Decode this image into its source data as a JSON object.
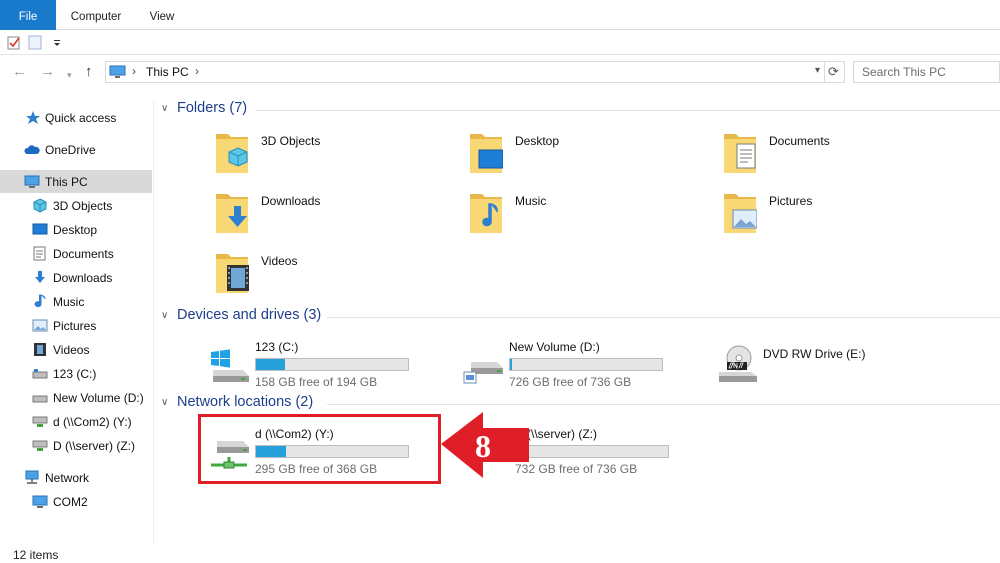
{
  "ribbon": {
    "tabs": [
      "File",
      "Computer",
      "View"
    ]
  },
  "address": {
    "path": "This PC",
    "search_placeholder": "Search This PC"
  },
  "sidebar": {
    "items": [
      {
        "label": "Quick access",
        "icon": "star-icon"
      },
      {
        "label": "OneDrive",
        "icon": "cloud-icon"
      },
      {
        "label": "This PC",
        "icon": "monitor-icon"
      },
      {
        "label": "3D Objects",
        "icon": "cube-icon"
      },
      {
        "label": "Desktop",
        "icon": "desktop-icon"
      },
      {
        "label": "Documents",
        "icon": "document-icon"
      },
      {
        "label": "Downloads",
        "icon": "download-icon"
      },
      {
        "label": "Music",
        "icon": "music-icon"
      },
      {
        "label": "Pictures",
        "icon": "pictures-icon"
      },
      {
        "label": "Videos",
        "icon": "videos-icon"
      },
      {
        "label": "123 (C:)",
        "icon": "drive-icon"
      },
      {
        "label": "New Volume (D:)",
        "icon": "drive-icon"
      },
      {
        "label": "d (\\\\Com2) (Y:)",
        "icon": "network-drive-icon"
      },
      {
        "label": "D (\\\\server) (Z:)",
        "icon": "network-drive-icon"
      },
      {
        "label": "Network",
        "icon": "network-icon"
      },
      {
        "label": "COM2",
        "icon": "computer-icon"
      }
    ]
  },
  "groups": {
    "folders": {
      "title": "Folders (7)",
      "items": [
        "3D Objects",
        "Desktop",
        "Documents",
        "Downloads",
        "Music",
        "Pictures",
        "Videos"
      ]
    },
    "devices": {
      "title": "Devices and drives (3)",
      "items": [
        {
          "label": "123 (C:)",
          "free": "158 GB free of 194 GB",
          "used_fraction": 0.19
        },
        {
          "label": "New Volume (D:)",
          "free": "726 GB free of 736 GB",
          "used_fraction": 0.014
        },
        {
          "label": "DVD RW Drive (E:)"
        }
      ]
    },
    "network": {
      "title": "Network locations (2)",
      "items": [
        {
          "label": "d (\\\\Com2) (Y:)",
          "free": "295 GB free of 368 GB",
          "used_fraction": 0.2
        },
        {
          "label": "D (\\\\server) (Z:)",
          "free": "732 GB free of 736 GB",
          "used_fraction": 0.005
        }
      ]
    }
  },
  "annotation": {
    "step": "8"
  },
  "status": {
    "count": "12 items"
  },
  "colors": {
    "accent": "#1979ca",
    "bar": "#26a0da",
    "highlight": "#e01e28",
    "folder": "#f8d775"
  }
}
